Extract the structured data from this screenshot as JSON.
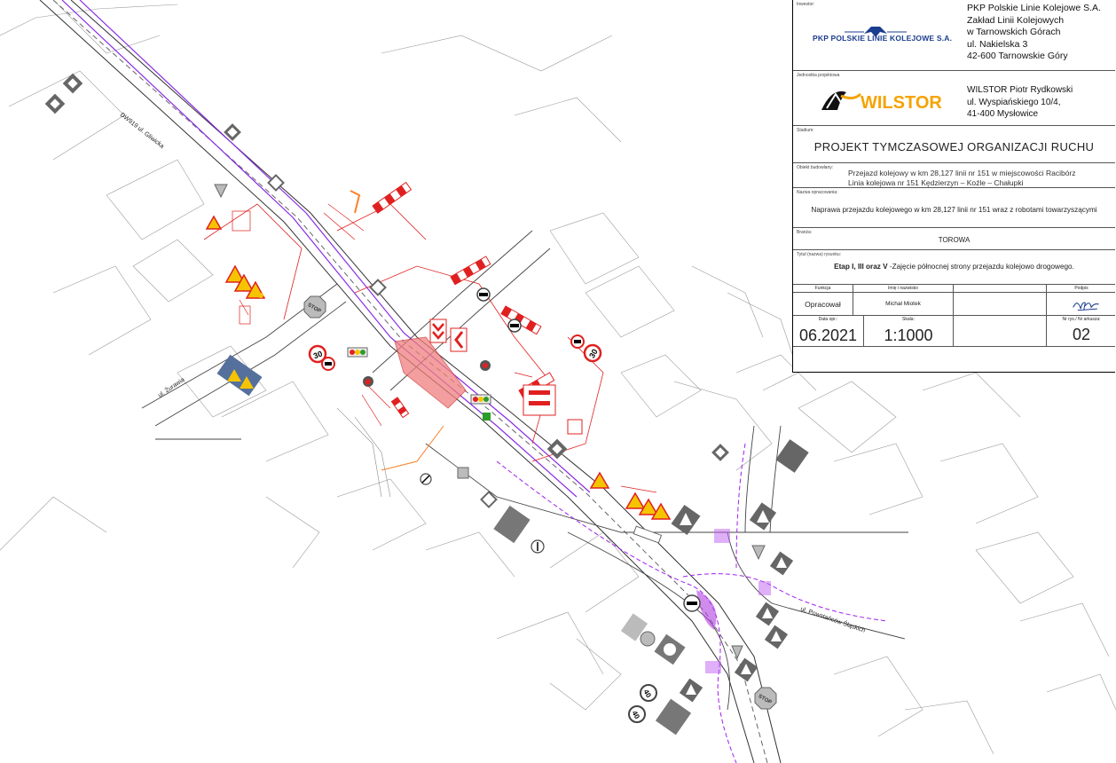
{
  "title_block": {
    "investor_label": "Inwestor:",
    "investor_logo_text": "PKP POLSKIE LINIE KOLEJOWE S.A.",
    "investor_lines": [
      "PKP Polskie Linie Kolejowe S.A.",
      "Zakład Linii Kolejowych",
      "w Tarnowskich Górach",
      "ul. Nakielska 3",
      "42-600 Tarnowskie Góry"
    ],
    "designer_label": "Jednostka projektowa",
    "designer_logo_text": "WILSTOR",
    "designer_lines": [
      "WILSTOR Piotr Rydkowski",
      "ul. Wyspiańskiego 10/4,",
      "41-400 Mysłowice"
    ],
    "stage_label": "Stadium:",
    "stage_value": "PROJEKT TYMCZASOWEJ ORGANIZACJI RUCHU",
    "object_label": "Obiekt budowlany:",
    "object_lines": [
      "Przejazd kolejowy w km 28,127 linii nr 151 w miejscowości Racibórz",
      "Linia kolejowa nr 151 Kędzierzyn – Koźle – Chałupki"
    ],
    "work_label": "Nazwa opracowania:",
    "work_value": "Naprawa przejazdu kolejowego w km 28,127 linii nr 151 wraz z robotami towarzyszącymi",
    "branch_label": "Branża:",
    "branch_value": "TOROWA",
    "drawing_label": "Tytuł (nazwa) rysunku:",
    "drawing_value_bold": "Etap I, III oraz V",
    "drawing_value_rest": " -Zajęcie północnej strony przejazdu kolejowo drogowego.",
    "col_function": "Funkcja",
    "col_name": "Imię i nazwisko",
    "col_signature": "Podpis",
    "role": "Opracował",
    "person": "Michał Miotek",
    "date_label": "Data opr.:",
    "scale_label": "Skala:",
    "sheet_label": "Nr rys./ Nr arkusza:",
    "date_value": "06.2021",
    "scale_value": "1:1000",
    "sheet_value": "02"
  },
  "map": {
    "street_labels": [
      "DW919 ul. Gliwicka",
      "ul. Żurawia",
      "ul. Powstańców Śląskich"
    ],
    "speed_limits": [
      "30",
      "30",
      "40",
      "40"
    ],
    "stop_text": "STOP",
    "colors": {
      "road": "#555555",
      "rail": "#8a2be2",
      "signs_red": "#e02020",
      "closure": "#f08080",
      "warning": "#f5c400"
    }
  }
}
